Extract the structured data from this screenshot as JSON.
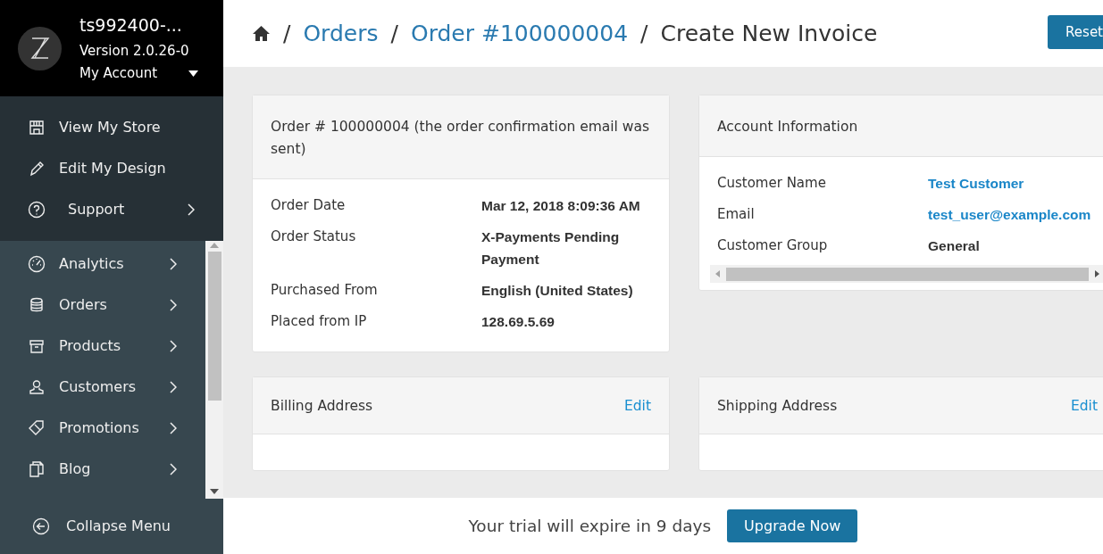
{
  "sidebar": {
    "store_name": "ts992400-...",
    "version": "Version 2.0.26-0",
    "account_label": "My Account",
    "top_items": [
      {
        "label": "View My Store",
        "expandable": false
      },
      {
        "label": "Edit My Design",
        "expandable": false
      },
      {
        "label": "Support",
        "expandable": true
      }
    ],
    "menu_items": [
      {
        "label": "Analytics",
        "expandable": true
      },
      {
        "label": "Orders",
        "expandable": true
      },
      {
        "label": "Products",
        "expandable": true
      },
      {
        "label": "Customers",
        "expandable": true
      },
      {
        "label": "Promotions",
        "expandable": true
      },
      {
        "label": "Blog",
        "expandable": true
      }
    ],
    "collapse_label": "Collapse Menu"
  },
  "breadcrumb": [
    {
      "kind": "home"
    },
    {
      "kind": "separator",
      "label": "/"
    },
    {
      "kind": "link",
      "label": "Orders"
    },
    {
      "kind": "separator",
      "label": "/"
    },
    {
      "kind": "link",
      "label": "Order #100000004"
    },
    {
      "kind": "separator",
      "label": "/"
    },
    {
      "kind": "current",
      "label": "Create New Invoice"
    }
  ],
  "header_button": "Reset",
  "order_card": {
    "title": "Order # 100000004 (the order confirmation email was sent)",
    "rows": [
      {
        "label": "Order Date",
        "value": "Mar 12, 2018 8:09:36 AM"
      },
      {
        "label": "Order Status",
        "value": "X-Payments Pending Payment"
      },
      {
        "label": "Purchased From",
        "value": "English (United States)"
      },
      {
        "label": "Placed from IP",
        "value": "128.69.5.69"
      }
    ]
  },
  "account_card": {
    "title": "Account Information",
    "rows": [
      {
        "label": "Customer Name",
        "value": "Test Customer",
        "kind": "link"
      },
      {
        "label": "Email",
        "value": "test_user@example.com",
        "kind": "link"
      },
      {
        "label": "Customer Group",
        "value": "General",
        "kind": "bold"
      }
    ]
  },
  "address_cards": [
    {
      "title": "Billing Address",
      "action": "Edit"
    },
    {
      "title": "Shipping Address",
      "action": "Edit"
    }
  ],
  "trial": {
    "message": "Your trial will expire in 9 days",
    "button": "Upgrade Now"
  }
}
